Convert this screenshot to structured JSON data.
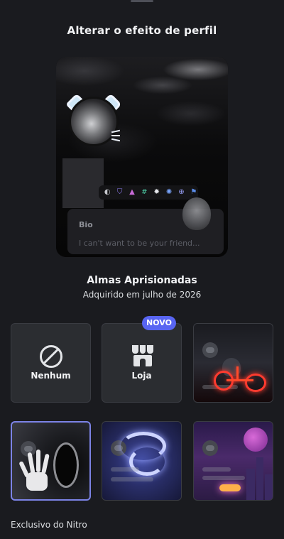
{
  "sheet": {
    "title": "Alterar o efeito de perfil"
  },
  "preview": {
    "bio_label": "Bio",
    "bio_text": "I can't want to be your friend...",
    "badges": [
      "◐",
      "⛉",
      "▲",
      "#",
      "✹",
      "✺",
      "⊕",
      "⚑"
    ]
  },
  "effect": {
    "name": "Almas Aprisionadas",
    "acquired": "Adquirido em julho de 2026"
  },
  "options": {
    "none_label": "Nenhum",
    "shop_label": "Loja",
    "new_badge": "NOVO"
  },
  "footer": {
    "section_label": "Exclusivo do Nitro"
  },
  "colors": {
    "accent": "#5865f2",
    "selected_border": "#7c83e6",
    "background": "#1a1b1f"
  }
}
